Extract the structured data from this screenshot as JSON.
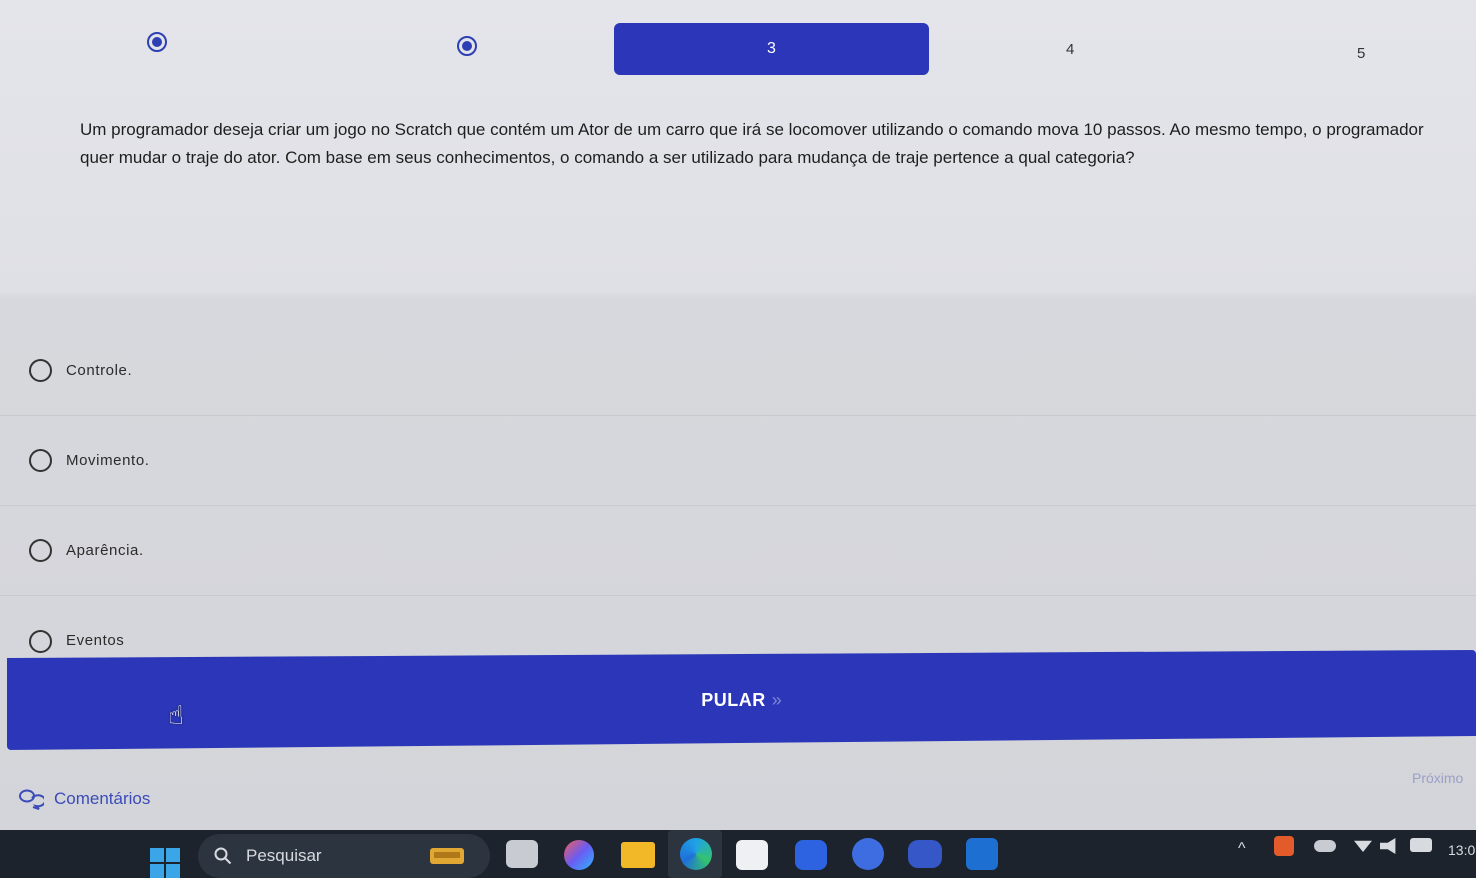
{
  "steps": {
    "current": "3",
    "next": [
      "4",
      "5"
    ]
  },
  "question": {
    "text": "Um programador deseja criar um jogo no Scratch que contém um Ator de um carro que irá se locomover utilizando o comando mova 10 passos. Ao mesmo tempo, o programador quer mudar o traje do ator. Com base em seus conhecimentos, o comando a ser utilizado para mudança de traje pertence a qual categoria?"
  },
  "options": [
    {
      "label": "Controle."
    },
    {
      "label": "Movimento."
    },
    {
      "label": "Aparência."
    },
    {
      "label": "Eventos"
    }
  ],
  "skip": {
    "label": "PULAR",
    "arrows": "»"
  },
  "comments": {
    "label": "Comentários"
  },
  "next_link": {
    "label": "Próximo"
  },
  "taskbar": {
    "search_label": "Pesquisar",
    "clock": "13:0"
  },
  "colors": {
    "accent": "#2b37b8",
    "taskbar": "#1c232c"
  }
}
